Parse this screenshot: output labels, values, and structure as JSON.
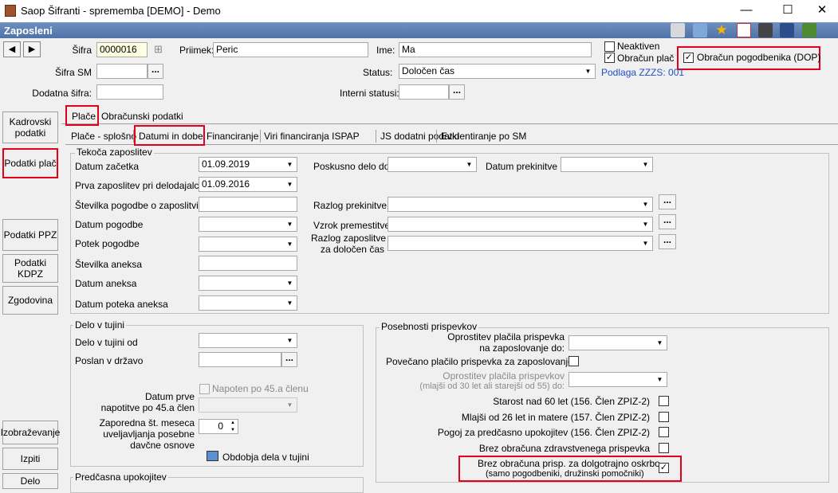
{
  "window": {
    "title": "Saop Šifranti - sprememba [DEMO] - Demo",
    "minimize": "—",
    "maximize": "☐",
    "close": "✕"
  },
  "header": {
    "section": "Zaposleni"
  },
  "toolbar_icons": [
    "edit-icon",
    "list-icon",
    "star-icon",
    "export-icon",
    "print-icon",
    "copy-icon",
    "exit-icon"
  ],
  "form": {
    "sifra_label": "Šifra",
    "sifra_value": "0000016",
    "priimek_label": "Priimek:",
    "priimek_value": "Peric",
    "ime_label": "Ime:",
    "ime_value": "Ma",
    "neaktiven_label": "Neaktiven",
    "obracun_plac_label": "Obračun plač",
    "obracun_pogodbenika_label": "Obračun pogodbenika (DOP)",
    "sifra_sm_label": "Šifra SM",
    "sifra_sm_value": "",
    "status_label": "Status:",
    "status_value": "Določen čas",
    "podlaga_label": "Podlaga ZZZS: 001",
    "dodatna_sifra_label": "Dodatna šifra:",
    "dodatna_sifra_value": "",
    "interni_statusi_label": "Interni statusi:",
    "interni_statusi_value": ""
  },
  "sidebar": [
    {
      "label": "Kadrovski podatki"
    },
    {
      "label": "Podatki plač"
    },
    {
      "label": "Podatki PPZ"
    },
    {
      "label": "Podatki KDPZ"
    },
    {
      "label": "Zgodovina"
    },
    {
      "label": "Izobraževanje"
    },
    {
      "label": "Izpiti"
    },
    {
      "label": "Delo"
    }
  ],
  "main_tabs": [
    {
      "label": "Plače"
    },
    {
      "label": "Obračunski podatki"
    }
  ],
  "sub_tabs": [
    {
      "label": "Plače - splošno"
    },
    {
      "label": "Datumi in dobe"
    },
    {
      "label": "Financiranje"
    },
    {
      "label": "Viri financiranja ISPAP"
    },
    {
      "label": "JS dodatni podatki"
    },
    {
      "label": "Evidentiranje po SM"
    }
  ],
  "tekoca": {
    "title": "Tekoča zaposlitev",
    "datum_zacetka_label": "Datum začetka",
    "datum_zacetka": "01.09.2019",
    "prva_zaposlitev_label": "Prva zaposlitev pri delodajalcu",
    "prva_zaposlitev": "01.09.2016",
    "stevilka_pogodbe_label": "Številka pogodbe o zaposlitvi",
    "datum_pogodbe_label": "Datum pogodbe",
    "potek_pogodbe_label": "Potek pogodbe",
    "stevilka_aneksa_label": "Številka aneksa",
    "datum_aneksa_label": "Datum aneksa",
    "datum_poteka_aneksa_label": "Datum poteka aneksa",
    "poskusno_delo_label": "Poskusno delo do",
    "datum_prekinitve_label": "Datum prekinitve",
    "razlog_prekinitve_label": "Razlog prekinitve",
    "vzrok_premestitve_label": "Vzrok premestitve",
    "razlog_zaposlitve_label1": "Razlog zaposlitve",
    "razlog_zaposlitve_label2": "za določen čas"
  },
  "tujina": {
    "title": "Delo v tujini",
    "delo_od_label": "Delo v tujini od",
    "poslan_label": "Poslan v državo",
    "napoten_label": "Napoten po 45.a členu",
    "datum_prve_label1": "Datum prve",
    "datum_prve_label2": "napotitve po 45.a člen",
    "zaporedna_label1": "Zaporedna št. meseca",
    "zaporedna_label2": "uveljavljanja posebne",
    "zaporedna_label3": "davčne osnove",
    "zaporedna_value": "0",
    "obdobja_label": "Obdobja dela v tujini"
  },
  "posebnosti": {
    "title": "Posebnosti prispevkov",
    "oprostitev_label1": "Oprostitev plačila prispevka",
    "oprostitev_label2": "na zaposlovanje do:",
    "povecano_label": "Povečano plačilo prispevka za zaposlovanje",
    "oprostitev_mladi_label1": "Oprostitev plačila prispevkov",
    "oprostitev_mladi_label2": "(mlajši od 30 let ali starejši od 55) do:",
    "starost_label": "Starost nad 60 let (156. Člen ZPIZ-2)",
    "mlajsi_label": "Mlajši od 26 let in matere (157. Člen ZPIZ-2)",
    "pogoj_label": "Pogoj za predčasno upokojitev (156. Člen ZPIZ-2)",
    "brez_zdrav_label": "Brez obračuna zdravstvenega prispevka",
    "brez_dolgo_label1": "Brez obračuna prisp. za dolgotrajno oskrbo",
    "brez_dolgo_label2": "(samo pogodbeniki, družinski pomočniki)"
  },
  "predcasna": {
    "title": "Predčasna upokojitev"
  },
  "glyphs": {
    "check": "✓",
    "dots": "...",
    "arrow_down": "▼",
    "arrow_left": "◀",
    "arrow_right": "▶",
    "spin_up": "▲",
    "spin_down": "▼",
    "expand": "⊞"
  }
}
